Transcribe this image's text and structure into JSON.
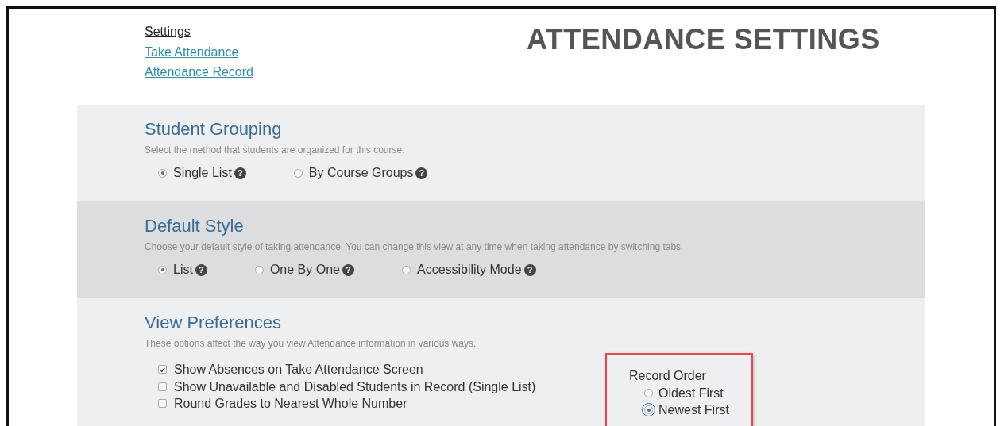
{
  "nav": [
    {
      "label": "Settings",
      "selected": true
    },
    {
      "label": "Take Attendance",
      "selected": false
    },
    {
      "label": "Attendance Record",
      "selected": false
    }
  ],
  "title": "ATTENDANCE SETTINGS",
  "sections": [
    {
      "heading": "Student Grouping",
      "description": "Select the method that students are organized for this course.",
      "kind": "radios",
      "options": [
        {
          "label": "Single List",
          "selected": true,
          "help": "?"
        },
        {
          "label": "By Course Groups",
          "selected": false,
          "help": "?"
        }
      ]
    },
    {
      "heading": "Default Style",
      "description": "Choose your default style of taking attendance. You can change this view at any time when taking attendance by switching tabs.",
      "kind": "radios",
      "options": [
        {
          "label": "List",
          "selected": true,
          "help": "?"
        },
        {
          "label": "One By One",
          "selected": false,
          "help": "?"
        },
        {
          "label": "Accessibility Mode",
          "selected": false,
          "help": "?"
        }
      ]
    },
    {
      "heading": "View Preferences",
      "description": "These options affect the way you view Attendance information in various ways.",
      "kind": "checks",
      "options": [
        {
          "label": "Show Absences on Take Attendance Screen",
          "checked": true
        },
        {
          "label": "Show Unavailable and Disabled Students in Record (Single List)",
          "checked": false
        },
        {
          "label": "Round Grades to Nearest Whole Number",
          "checked": false
        }
      ],
      "record_order": {
        "label": "Record Order",
        "highlighted": true,
        "options": [
          {
            "label": "Oldest First",
            "selected": false,
            "focused": false
          },
          {
            "label": "Newest First",
            "selected": true,
            "focused": true
          }
        ]
      }
    }
  ]
}
